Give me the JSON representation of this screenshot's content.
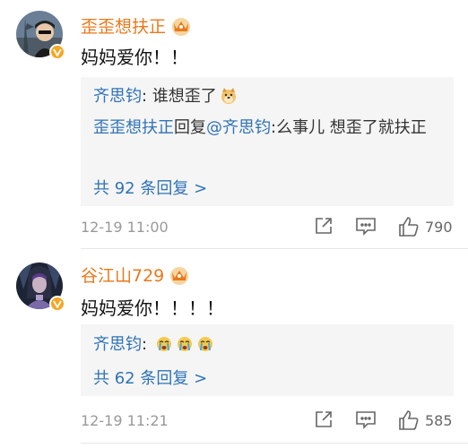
{
  "comments": [
    {
      "username": "歪歪想扶正",
      "text": "妈妈爱你！！",
      "replies": [
        {
          "name": "齐思钧",
          "text": ": 谁想歪了"
        },
        {
          "name": "歪歪想扶正",
          "middle": "回复",
          "mention": "@齐思钧",
          "text": ":么事儿 想歪了就扶正"
        }
      ],
      "more": "共 92 条回复 >",
      "time": "12-19 11:00",
      "likes": "790"
    },
    {
      "username": "谷江山729",
      "text": "妈妈爱你！！！！",
      "replies": [
        {
          "name": "齐思钧",
          "text": ": "
        }
      ],
      "more": "共 62 条回复 >",
      "time": "12-19 11:21",
      "likes": "585"
    }
  ],
  "icons": {
    "verified": "verified-badge-icon",
    "crown": "crown-icon",
    "share": "share-icon",
    "comment": "comment-icon",
    "like": "like-icon"
  },
  "colors": {
    "username": "#e8791c",
    "link": "#2f73b6",
    "badge": "#f5a623"
  }
}
